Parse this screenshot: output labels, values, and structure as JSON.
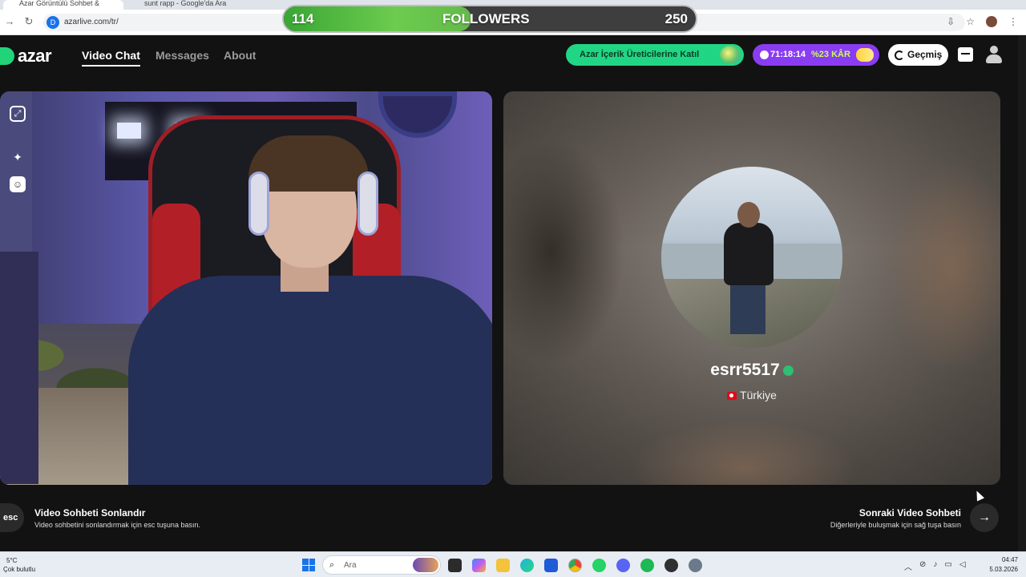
{
  "browser": {
    "tab_active_label": "Azar Görüntülü Sohbet &",
    "tab_other_label": "sunt rapp - Google'da Ara",
    "url": "azarlive.com/tr/"
  },
  "overlay": {
    "followers_current": "114",
    "followers_label": "FOLLOWERS",
    "followers_goal": "250",
    "progress_fraction": 0.456
  },
  "header": {
    "logo": "azar",
    "nav": [
      "Video Chat",
      "Messages",
      "About"
    ],
    "creator_banner": "Azar İçerik Üreticilerine Katıl",
    "timer": "71:18:14",
    "promo": "%23 KÂR",
    "history_label": "Geçmiş"
  },
  "partner": {
    "username": "esrr5517",
    "country": "Türkiye"
  },
  "footer": {
    "esc_key": "esc",
    "end_title": "Video Sohbeti Sonlandır",
    "end_sub": "Video sohbetini sonlandırmak için esc tuşuna basın.",
    "next_title": "Sonraki Video Sohbeti",
    "next_sub": "Diğerleriyle buluşmak için sağ tuşa basın"
  },
  "taskbar": {
    "weather_temp": "5°C",
    "weather_desc": "Çok bulutlu",
    "search_placeholder": "Ara",
    "time": "04:47",
    "date": "5.03.2026"
  },
  "colors": {
    "brand_green": "#20d685",
    "promo_purple": "#8a3cf2"
  }
}
